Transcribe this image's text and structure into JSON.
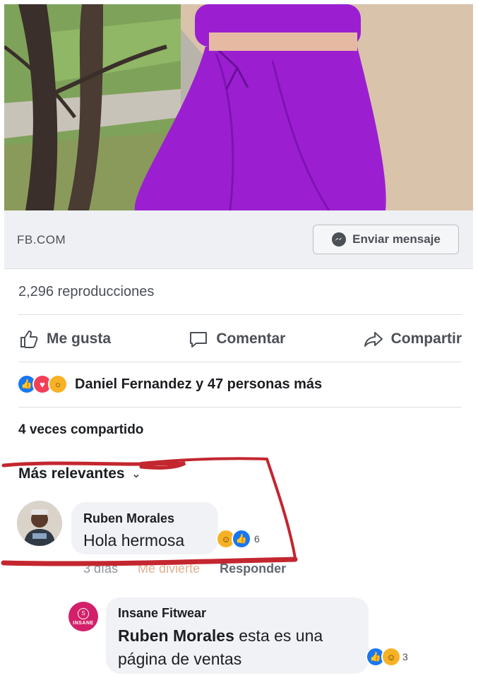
{
  "link_preview": {
    "domain": "FB.COM",
    "send_message_label": "Enviar mensaje"
  },
  "stats": {
    "views": "2,296 reproducciones",
    "reactions_text": "Daniel Fernandez y 47 personas más",
    "shares": "4 veces compartido"
  },
  "actions": {
    "like": "Me gusta",
    "comment": "Comentar",
    "share": "Compartir"
  },
  "comments_header": {
    "sort_label": "Más relevantes"
  },
  "comments": [
    {
      "author": "Ruben Morales",
      "text": "Hola hermosa",
      "reaction_count": "6",
      "time": "3 días",
      "like_label": "Me divierte",
      "reply_label": "Responder"
    }
  ],
  "reply": {
    "author": "Insane Fitwear",
    "mention": "Ruben Morales",
    "text": " esta es una página de ventas",
    "reaction_count": "3",
    "avatar_brand": "INSANE"
  },
  "colors": {
    "accent_red": "#c3262f",
    "like_blue": "#1877f2",
    "love_red": "#f33e58",
    "haha_yellow": "#f7b125",
    "outfit_purple": "#9b1fd1"
  },
  "icons": [
    "messenger-icon",
    "thumbs-up-icon",
    "speech-bubble-icon",
    "share-arrow-icon",
    "like-reaction-icon",
    "love-reaction-icon",
    "wow-reaction-icon",
    "haha-reaction-icon",
    "chevron-down-icon"
  ]
}
